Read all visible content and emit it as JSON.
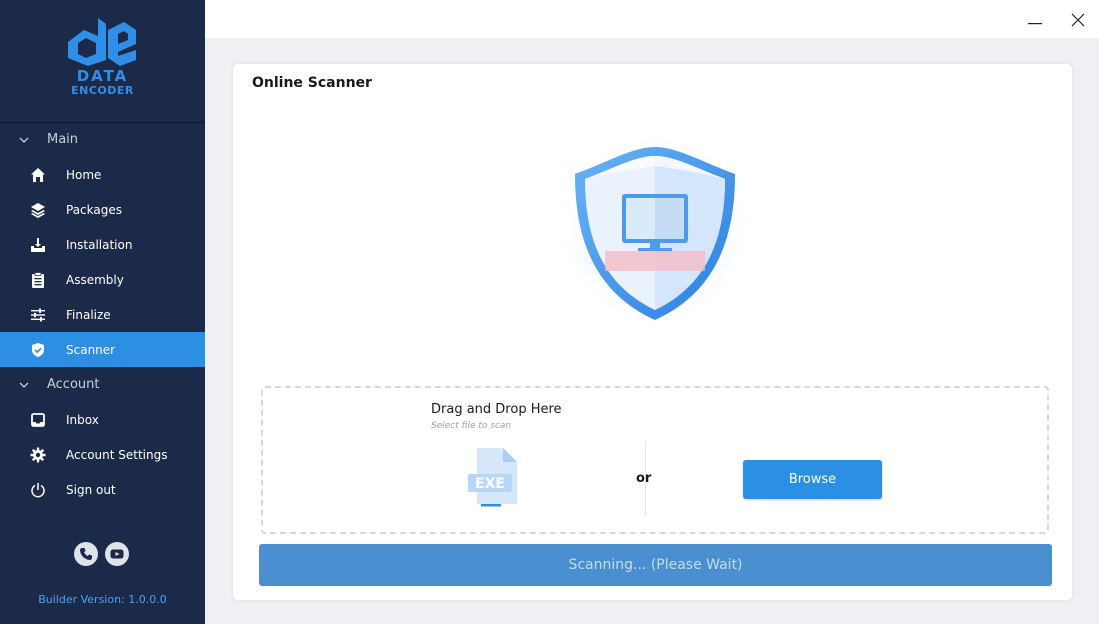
{
  "brand": {
    "logo_line1": "DATA",
    "logo_line2": "ENCODER"
  },
  "sidebar": {
    "sections": [
      {
        "label": "Main",
        "items": [
          {
            "label": "Home",
            "icon": "home-icon"
          },
          {
            "label": "Packages",
            "icon": "layers-icon"
          },
          {
            "label": "Installation",
            "icon": "install-icon"
          },
          {
            "label": "Assembly",
            "icon": "clipboard-icon"
          },
          {
            "label": "Finalize",
            "icon": "sliders-icon"
          },
          {
            "label": "Scanner",
            "icon": "shield-check-icon",
            "active": true
          }
        ]
      },
      {
        "label": "Account",
        "items": [
          {
            "label": "Inbox",
            "icon": "inbox-icon"
          },
          {
            "label": "Account Settings",
            "icon": "gear-icon"
          },
          {
            "label": "Sign out",
            "icon": "power-icon"
          }
        ]
      }
    ],
    "version": "Builder Version: 1.0.0.0"
  },
  "main": {
    "title": "Online Scanner",
    "dropzone": {
      "title": "Drag and Drop Here",
      "subtitle": "Select file to scan",
      "file_badge": "EXE",
      "or_label": "or",
      "browse_label": "Browse"
    },
    "scan_status": "Scanning... (Please Wait)"
  },
  "colors": {
    "sidebar_bg": "#1c2a49",
    "accent": "#2b8fe3",
    "scanbar": "#4a90d0"
  }
}
